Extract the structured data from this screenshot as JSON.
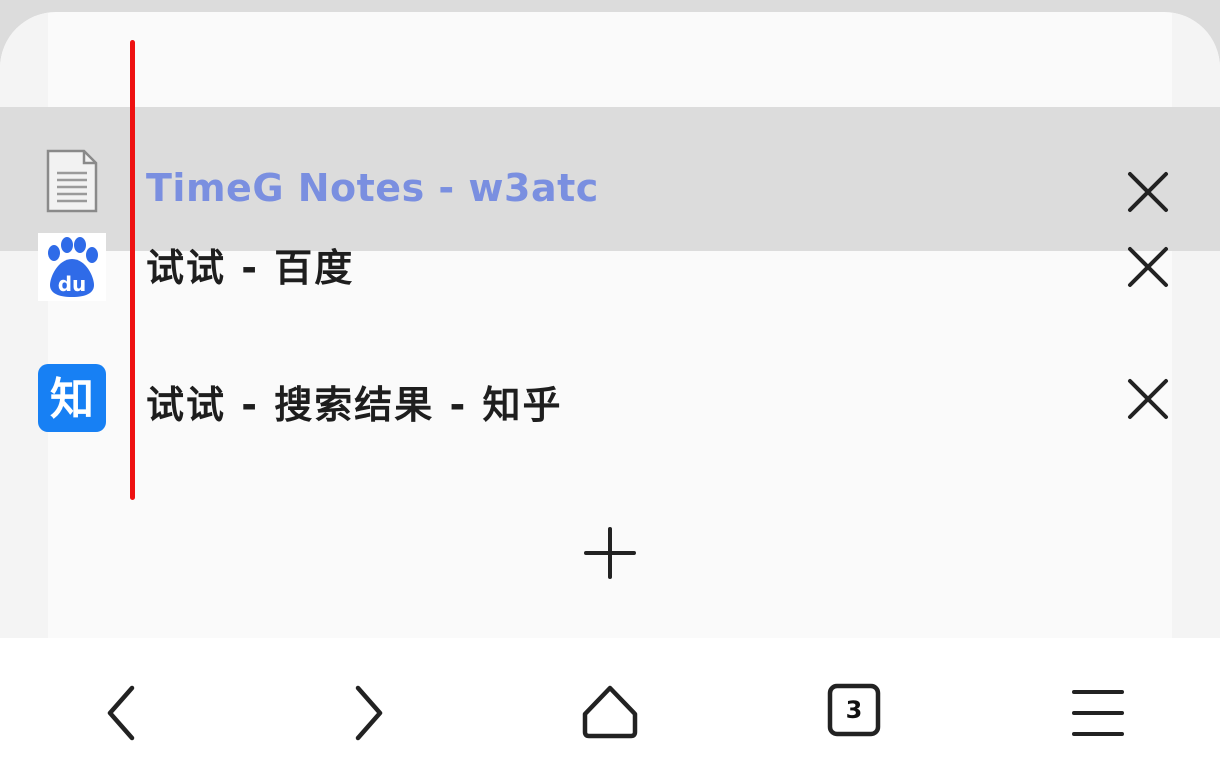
{
  "tabs": [
    {
      "title": "TimeG Notes - w3atc",
      "favicon": "document-icon",
      "active": true
    },
    {
      "title": "试试 - 百度",
      "favicon": "baidu-icon",
      "active": false
    },
    {
      "title": "试试 - 搜索结果 - 知乎",
      "favicon": "zhihu-icon",
      "active": false
    }
  ],
  "baidu_label": "du",
  "zhihu_label": "知",
  "toolbar": {
    "back": "chevron-left-icon",
    "forward": "chevron-right-icon",
    "home": "home-icon",
    "tab_count": "3",
    "menu": "menu-icon"
  },
  "colors": {
    "active_title": "#7a8fe0",
    "active_row": "#dcdcdc",
    "drag_indicator": "#ee1111",
    "baidu_blue": "#2f6be8",
    "zhihu_blue": "#1780f4"
  }
}
